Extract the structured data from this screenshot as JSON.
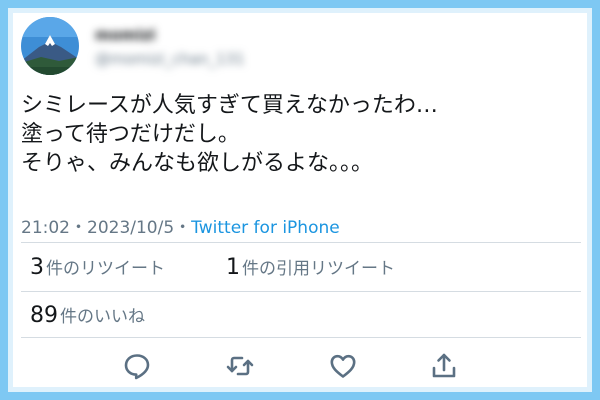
{
  "tweet": {
    "author_name": "momizi",
    "author_handle": "@momizi_chan_131",
    "lines": [
      "シミレースが人気すぎて買えなかったわ…",
      "塗って待つだけだし。",
      "そりゃ、みんなも欲しがるよな。。。"
    ],
    "time": "21:02",
    "date": "2023/10/5",
    "source": "Twitter for iPhone"
  },
  "stats": {
    "retweets_count": "3",
    "retweets_label": "件のリツイート",
    "quotes_count": "1",
    "quotes_label": "件の引用リツイート",
    "likes_count": "89",
    "likes_label": "件のいいね"
  },
  "actions": [
    "reply-icon",
    "retweet-icon",
    "like-icon",
    "share-icon"
  ],
  "colors": {
    "background": "#7ec8f3",
    "link": "#1b95e0",
    "icon": "#5b7083"
  }
}
